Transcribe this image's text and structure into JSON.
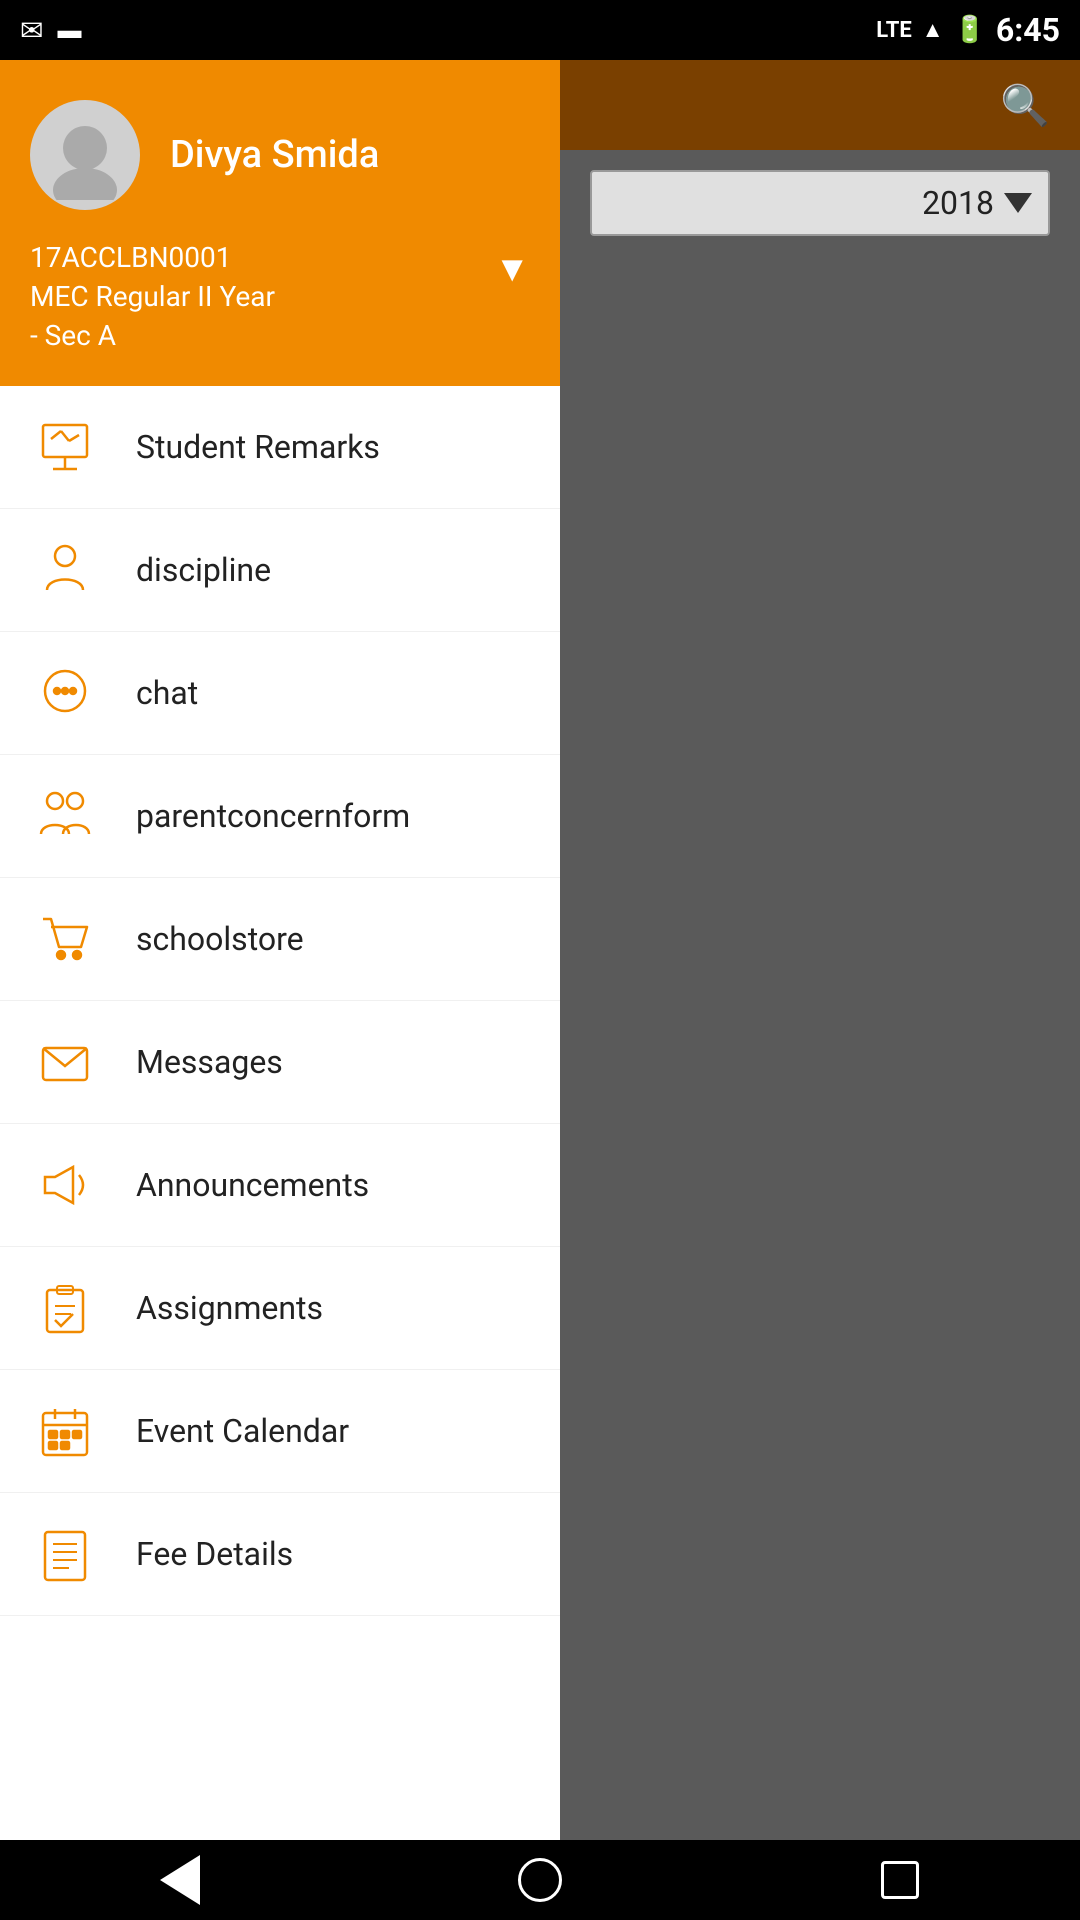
{
  "statusBar": {
    "time": "6:45",
    "lte": "LTE"
  },
  "rightPanel": {
    "year": "2018",
    "yearAriaLabel": "Year selector"
  },
  "drawer": {
    "user": {
      "name": "Divya Smida",
      "studentId": "17ACCLBN0001",
      "class": "MEC Regular II Year",
      "section": "- Sec A"
    },
    "menuItems": [
      {
        "id": "student-remarks",
        "label": "Student Remarks",
        "icon": "presentation"
      },
      {
        "id": "discipline",
        "label": "discipline",
        "icon": "person"
      },
      {
        "id": "chat",
        "label": "chat",
        "icon": "chat"
      },
      {
        "id": "parentconcernform",
        "label": "parentconcernform",
        "icon": "parents"
      },
      {
        "id": "schoolstore",
        "label": "schoolstore",
        "icon": "cart"
      },
      {
        "id": "messages",
        "label": "Messages",
        "icon": "envelope"
      },
      {
        "id": "announcements",
        "label": "Announcements",
        "icon": "megaphone"
      },
      {
        "id": "assignments",
        "label": "Assignments",
        "icon": "clipboard"
      },
      {
        "id": "event-calendar",
        "label": "Event Calendar",
        "icon": "calendar"
      },
      {
        "id": "fee-details",
        "label": "Fee Details",
        "icon": "list"
      }
    ]
  },
  "bottomNav": {
    "back": "back",
    "home": "home",
    "recents": "recents"
  }
}
